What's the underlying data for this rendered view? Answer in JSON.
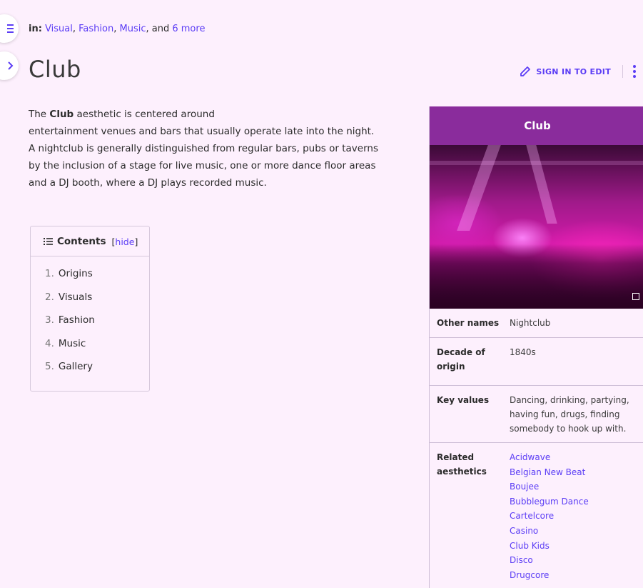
{
  "categories": {
    "label": "in:",
    "links": [
      "Visual",
      "Fashion",
      "Music"
    ],
    "and": "and",
    "more": "6 more"
  },
  "title": "Club",
  "actions": {
    "edit": "SIGN IN TO EDIT"
  },
  "intro": {
    "l1_pre": "The",
    "l1_bold": "Club",
    "l1_post": "aesthetic is centered around",
    "l2": "entertainment venues and bars that usually operate late into the night.",
    "l3": "A nightclub is generally distinguished from regular bars, pubs or taverns",
    "l4": "by the inclusion of a stage for live music, one or more dance floor areas",
    "l5": "and a DJ booth, where a DJ plays recorded music."
  },
  "toc": {
    "title": "Contents",
    "hide_open": "[",
    "hide": "hide",
    "hide_close": "]",
    "items": [
      {
        "num": "1.",
        "label": "Origins"
      },
      {
        "num": "2.",
        "label": "Visuals"
      },
      {
        "num": "3.",
        "label": "Fashion"
      },
      {
        "num": "4.",
        "label": "Music"
      },
      {
        "num": "5.",
        "label": "Gallery"
      }
    ]
  },
  "infobox": {
    "title": "Club",
    "other_names_label": "Other names",
    "other_names": "Nightclub",
    "decade_label": "Decade of origin",
    "decade": "1840s",
    "key_values_label": "Key values",
    "key_values": "Dancing, drinking, partying, having fun, drugs, finding somebody to hook up with.",
    "related_label": "Related aesthetics",
    "related": [
      "Acidwave",
      "Belgian New Beat",
      "Boujee",
      "Bubblegum Dance",
      "Cartelcore",
      "Casino",
      "Club Kids",
      "Disco",
      "Drugcore"
    ]
  },
  "colors": {
    "accent": "#5b3df5",
    "infobox_header": "#8a2c9c",
    "background": "#fdf0fd"
  }
}
